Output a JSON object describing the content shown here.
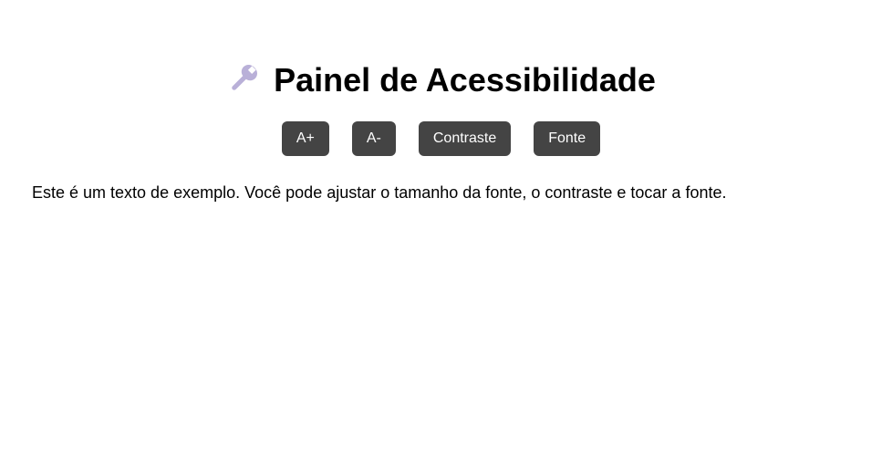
{
  "panel": {
    "title": "Painel de Acessibilidade",
    "title_icon": "wrench-icon",
    "icon_color": "#b9b0d8"
  },
  "controls": {
    "increase_label": "A+",
    "decrease_label": "A-",
    "contrast_label": "Contraste",
    "font_label": "Fonte",
    "button_color": "#444444"
  },
  "content": {
    "sample_text": "Este é um texto de exemplo. Você pode ajustar o tamanho da fonte, o contraste e tocar a fonte."
  }
}
